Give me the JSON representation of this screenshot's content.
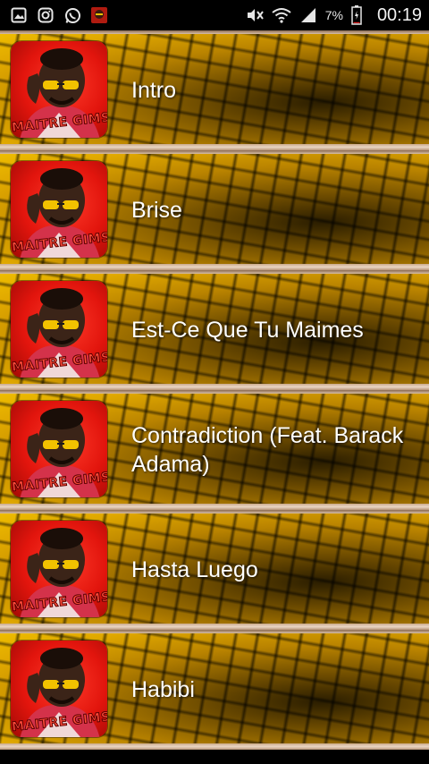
{
  "status_bar": {
    "icons_left": [
      "gallery-icon",
      "instagram-icon",
      "whatsapp-icon",
      "app-icon"
    ],
    "icons_right": [
      "mute-icon",
      "wifi-icon",
      "signal-icon"
    ],
    "battery_percent": "7%",
    "battery_level": 0.07,
    "time": "00:19"
  },
  "songs": [
    {
      "title": "Intro",
      "cover_label": "MAITRE GIMS"
    },
    {
      "title": "Brise",
      "cover_label": "MAITRE GIMS"
    },
    {
      "title": "Est-Ce Que Tu Maimes",
      "cover_label": "MAITRE GIMS"
    },
    {
      "title": "Contradiction (Feat. Barack Adama)",
      "cover_label": "MAITRE GIMS"
    },
    {
      "title": "Hasta Luego",
      "cover_label": "MAITRE GIMS"
    },
    {
      "title": "Habibi",
      "cover_label": "MAITRE GIMS"
    }
  ]
}
